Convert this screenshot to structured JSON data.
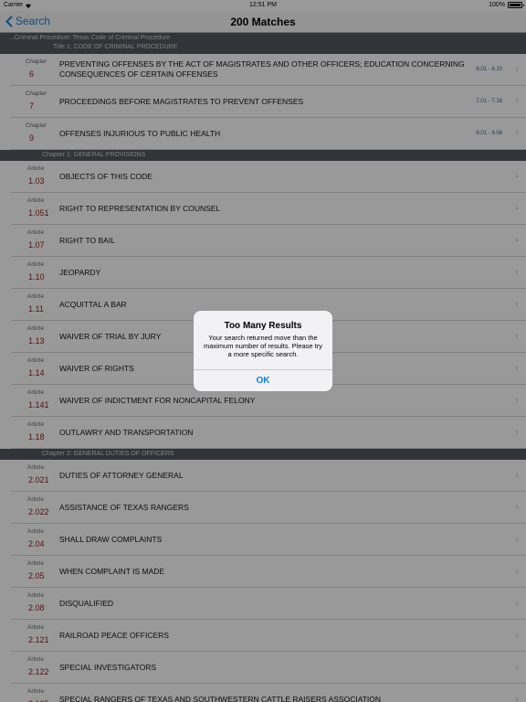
{
  "status_bar": {
    "carrier": "Carrier",
    "time": "12:51 PM",
    "battery": "100%"
  },
  "nav": {
    "back_label": "Search",
    "title": "200 Matches"
  },
  "breadcrumb": {
    "line1": "...Criminal Procedure: Texas Code of Criminal Procedure",
    "line2": "Title 1: CODE OF CRIMINAL PROCEDURE"
  },
  "chapters": [
    {
      "kind": "Chapter",
      "num": "6",
      "title": "PREVENTING OFFENSES BY THE ACT OF MAGISTRATES AND OTHER OFFICERS; EDUCATION CONCERNING CONSEQUENCES OF CERTAIN OFFENSES",
      "range": "6.01 - 6.10"
    },
    {
      "kind": "Chapter",
      "num": "7",
      "title": "PROCEEDINGS BEFORE MAGISTRATES TO PREVENT OFFENSES",
      "range": "7.01 - 7.18"
    },
    {
      "kind": "Chapter",
      "num": "9",
      "title": "OFFENSES INJURIOUS TO PUBLIC HEALTH",
      "range": "9.01 - 9.06"
    }
  ],
  "section1": {
    "header": "Chapter 1: GENERAL PROVISIONS",
    "articles": [
      {
        "kind": "Article",
        "num": "1.03",
        "title": "OBJECTS OF THIS CODE"
      },
      {
        "kind": "Article",
        "num": "1.051",
        "title": "RIGHT TO REPRESENTATION BY COUNSEL"
      },
      {
        "kind": "Article",
        "num": "1.07",
        "title": "RIGHT TO BAIL"
      },
      {
        "kind": "Article",
        "num": "1.10",
        "title": "JEOPARDY"
      },
      {
        "kind": "Article",
        "num": "1.11",
        "title": "ACQUITTAL A BAR"
      },
      {
        "kind": "Article",
        "num": "1.13",
        "title": "WAIVER OF TRIAL BY JURY"
      },
      {
        "kind": "Article",
        "num": "1.14",
        "title": "WAIVER OF RIGHTS"
      },
      {
        "kind": "Article",
        "num": "1.141",
        "title": "WAIVER OF INDICTMENT FOR NONCAPITAL FELONY"
      },
      {
        "kind": "Article",
        "num": "1.18",
        "title": "OUTLAWRY AND TRANSPORTATION"
      }
    ]
  },
  "section2": {
    "header": "Chapter 2: GENERAL DUTIES OF OFFICERS",
    "articles": [
      {
        "kind": "Article",
        "num": "2.021",
        "title": "DUTIES OF ATTORNEY GENERAL"
      },
      {
        "kind": "Article",
        "num": "2.022",
        "title": "ASSISTANCE OF TEXAS RANGERS"
      },
      {
        "kind": "Article",
        "num": "2.04",
        "title": "SHALL DRAW COMPLAINTS"
      },
      {
        "kind": "Article",
        "num": "2.05",
        "title": "WHEN COMPLAINT IS MADE"
      },
      {
        "kind": "Article",
        "num": "2.08",
        "title": "DISQUALIFIED"
      },
      {
        "kind": "Article",
        "num": "2.121",
        "title": "RAILROAD PEACE OFFICERS"
      },
      {
        "kind": "Article",
        "num": "2.122",
        "title": "SPECIAL INVESTIGATORS"
      },
      {
        "kind": "Article",
        "num": "2.125",
        "title": "SPECIAL RANGERS OF TEXAS AND SOUTHWESTERN CATTLE RAISERS ASSOCIATION"
      }
    ]
  },
  "alert": {
    "title": "Too Many Results",
    "message": "Your search returned move than the maximum number of results. Please try a more specific search.",
    "button": "OK"
  },
  "colors": {
    "accent": "#1a7dd6",
    "section_header": "#53575e",
    "number": "#8b1a1a",
    "range": "#2d5fa6"
  }
}
